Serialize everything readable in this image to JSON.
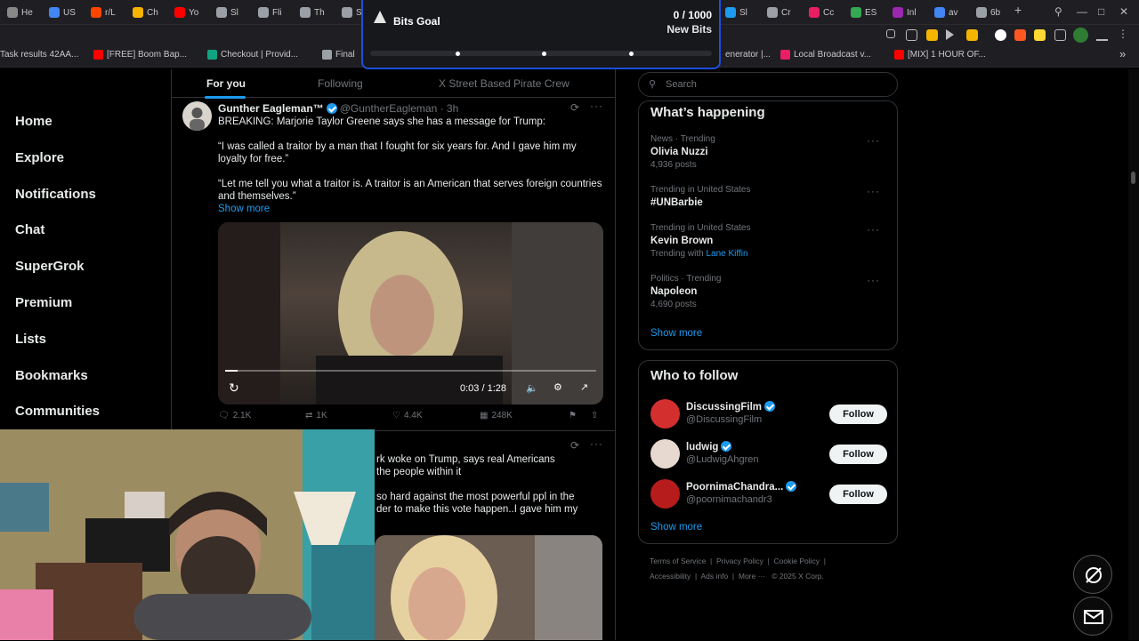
{
  "browser": {
    "tabs": [
      {
        "label": "He",
        "color": "#888"
      },
      {
        "label": "US",
        "color": "#4285f4"
      },
      {
        "label": "r/L",
        "color": "#ff4500"
      },
      {
        "label": "Ch",
        "color": "#f4b400"
      },
      {
        "label": "Yo",
        "color": "#ff0000"
      },
      {
        "label": "Sl",
        "color": "#9aa0a6"
      },
      {
        "label": "Fli",
        "color": "#9aa0a6"
      },
      {
        "label": "Th",
        "color": "#9aa0a6"
      },
      {
        "label": "SB",
        "color": "#9aa0a6"
      }
    ],
    "tabs_right": [
      {
        "label": "Sl",
        "color": "#1d9bf0"
      },
      {
        "label": "Cr",
        "color": "#9aa0a6"
      },
      {
        "label": "Cc",
        "color": "#e91e63"
      },
      {
        "label": "ES",
        "color": "#34a853"
      },
      {
        "label": "Inl",
        "color": "#9c27b0"
      },
      {
        "label": "av",
        "color": "#4285f4"
      },
      {
        "label": "6b",
        "color": "#9aa0a6"
      }
    ],
    "new_tab": "+",
    "bookmarks": [
      {
        "label": "Task results 42AA...",
        "color": ""
      },
      {
        "label": "[FREE] Boom Bap...",
        "color": "#ff0000"
      },
      {
        "label": "Checkout | Provid...",
        "color": "#10a37f"
      },
      {
        "label": "Final",
        "color": "#9aa0a6"
      }
    ],
    "bookmarks_right": [
      {
        "label": "enerator |...",
        "color": ""
      },
      {
        "label": "Local Broadcast v...",
        "color": "#e91e63"
      },
      {
        "label": "[MIX] 1 HOUR OF...",
        "color": "#ff0000"
      }
    ],
    "bookmarks_overflow": "»"
  },
  "bits_goal": {
    "name": "Bits Goal",
    "count": "0 / 1000",
    "unit": "New Bits",
    "progress": 0
  },
  "nav": {
    "items": [
      "Home",
      "Explore",
      "Notifications",
      "Chat",
      "SuperGrok",
      "Premium",
      "Lists",
      "Bookmarks",
      "Communities"
    ]
  },
  "timeline": {
    "tabs": [
      "For you",
      "Following",
      "X Street Based Pirate Crew"
    ]
  },
  "post1": {
    "name": "Gunther Eagleman™",
    "handle": "@GuntherEagleman · 3h",
    "line1": "BREAKING: Marjorie Taylor Greene says she has a message for Trump:",
    "line2": "“I was called a traitor by a man that I fought for six years for. And I gave him my loyalty for free.”",
    "line3": "“Let me tell you what a traitor is. A traitor is an American that serves foreign countries and themselves.”",
    "show_more": "Show more",
    "video_time": "0:03 / 1:28",
    "video_progress": 0.034,
    "replies": "2.1K",
    "reposts": "1K",
    "likes": "4.4K",
    "views": "248K"
  },
  "post2": {
    "line1": "rk woke on Trump, says real Americans",
    "line2": "the people within it",
    "line3": "so hard against the most powerful ppl in the",
    "line4": "der to make this vote happen..I gave him my"
  },
  "sidebar": {
    "search_placeholder": "Search",
    "happening_title": "What’s happening",
    "trends": [
      {
        "meta": "News · Trending",
        "title": "Olivia Nuzzi",
        "sub": "4,936 posts"
      },
      {
        "meta": "Trending in United States",
        "title": "#UNBarbie",
        "sub": ""
      },
      {
        "meta": "Trending in United States",
        "title": "Kevin Brown",
        "sub_prefix": "Trending with",
        "sub_link": "Lane Kiffin"
      },
      {
        "meta": "Politics · Trending",
        "title": "Napoleon",
        "sub": "4,690 posts"
      }
    ],
    "show_more": "Show more",
    "wtf_title": "Who to follow",
    "follow": [
      {
        "name": "DiscussingFilm",
        "handle": "@DiscussingFilm",
        "color": "#d32f2f"
      },
      {
        "name": "ludwig",
        "handle": "@LudwigAhgren",
        "color": "#e8d9d0"
      },
      {
        "name": "PoornimaChandra...",
        "handle": "@poornimachandr3",
        "color": "#b71c1c"
      }
    ],
    "follow_label": "Follow",
    "footer_line1": [
      "Terms of Service",
      "Privacy Policy",
      "Cookie Policy"
    ],
    "footer_line2": [
      "Accessibility",
      "Ads info",
      "More ···",
      "© 2025 X Corp."
    ]
  },
  "colors": {
    "accent": "#1d9bf0",
    "bits_border": "#1d4ed8"
  }
}
